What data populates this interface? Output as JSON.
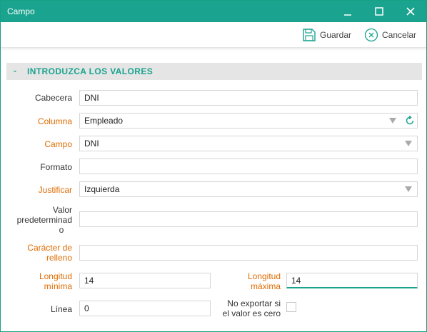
{
  "window": {
    "title": "Campo"
  },
  "toolbar": {
    "save_label": "Guardar",
    "cancel_label": "Cancelar"
  },
  "section": {
    "toggle": "-",
    "title": "INTRODUZCA LOS VALORES"
  },
  "form": {
    "cabecera": {
      "label": "Cabecera",
      "value": "DNI"
    },
    "columna": {
      "label": "Columna",
      "value": "Empleado"
    },
    "campo": {
      "label": "Campo",
      "value": "DNI"
    },
    "formato": {
      "label": "Formato",
      "value": ""
    },
    "justificar": {
      "label": "Justificar",
      "value": "Izquierda"
    },
    "valor_predeterminado": {
      "label_line1": "Valor",
      "label_line2": "predeterminad",
      "label_line3": "o",
      "value": ""
    },
    "caracter_relleno": {
      "label_line1": "Carácter de",
      "label_line2": "relleno",
      "value": ""
    },
    "longitud_minima": {
      "label_line1": "Longitud",
      "label_line2": "mínima",
      "value": "14"
    },
    "longitud_maxima": {
      "label_line1": "Longitud",
      "label_line2": "máxima",
      "value": "14"
    },
    "linea": {
      "label": "Línea",
      "value": "0"
    },
    "no_exportar": {
      "label_line1": "No exportar si",
      "label_line2": "el valor es cero",
      "checked": false
    }
  },
  "colors": {
    "accent": "#1aa38f",
    "required_label": "#e06a00",
    "section_bg": "#e5e5e5"
  }
}
